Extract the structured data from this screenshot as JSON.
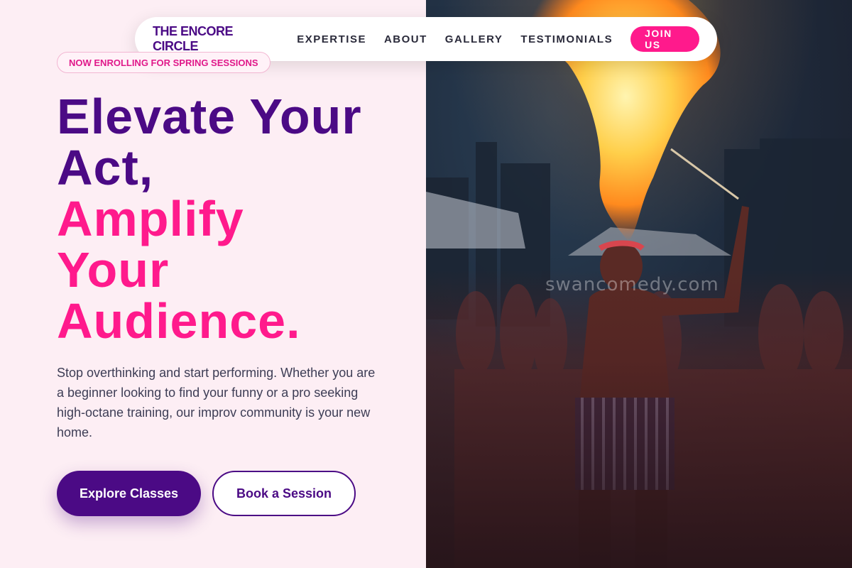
{
  "brand": {
    "name": "THE ENCORE CIRCLE"
  },
  "nav": {
    "links": [
      "EXPERTISE",
      "ABOUT",
      "GALLERY",
      "TESTIMONIALS"
    ],
    "cta": "JOIN US"
  },
  "hero": {
    "badge": "NOW ENROLLING FOR SPRING SESSIONS",
    "headline_line1": "Elevate Your",
    "headline_line2": "Act,",
    "headline_line3": "Amplify",
    "headline_line4": "Your",
    "headline_line5": "Audience.",
    "description": "Stop overthinking and start performing. Whether you are a beginner looking to find your funny or a pro seeking high-octane training, our improv community is your new home.",
    "primary_button": "Explore Classes",
    "secondary_button": "Book a Session"
  },
  "image": {
    "watermark": "swancomedy.com",
    "subject": "fire-breather performing at night festival"
  },
  "colors": {
    "brand_purple": "#4b0a85",
    "accent_pink": "#ff1a8c",
    "background": "#fdeef4"
  }
}
